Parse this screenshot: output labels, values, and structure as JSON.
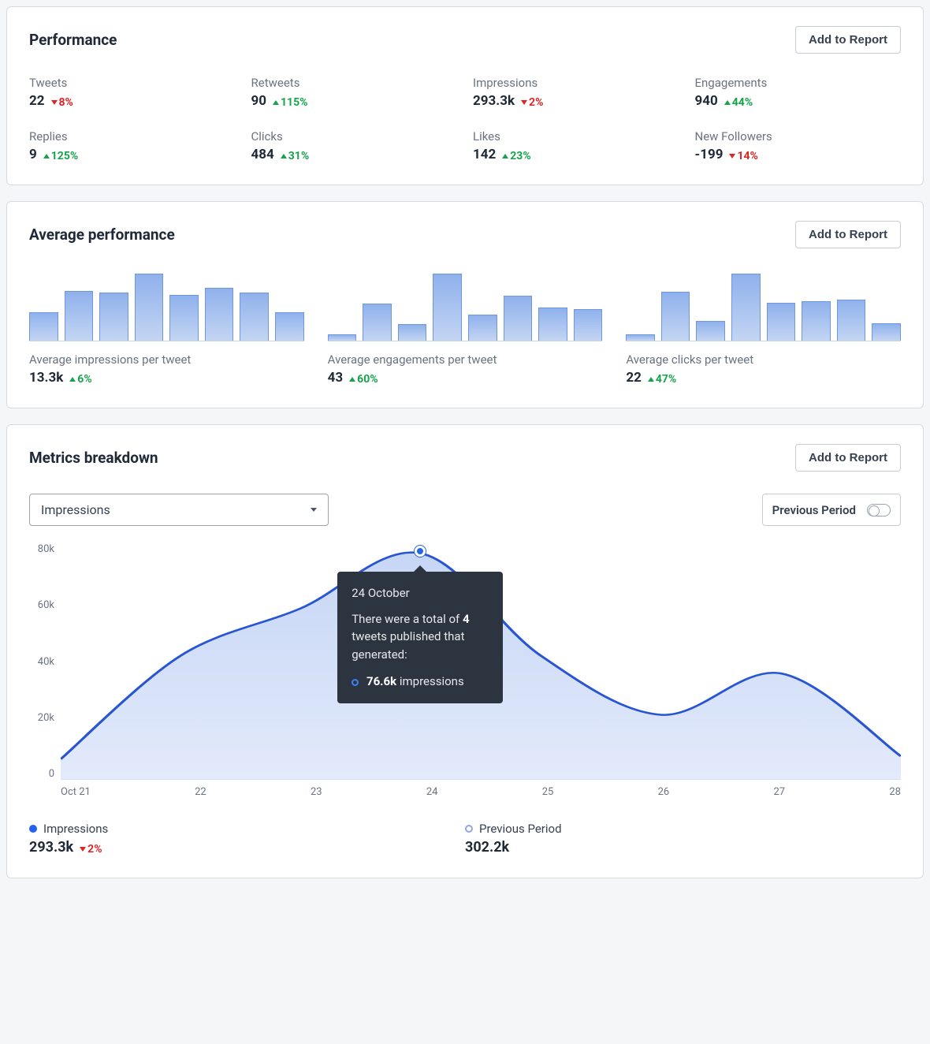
{
  "performance": {
    "title": "Performance",
    "add_btn": "Add to Report",
    "metrics": [
      {
        "label": "Tweets",
        "value": "22",
        "delta": "8%",
        "dir": "down"
      },
      {
        "label": "Retweets",
        "value": "90",
        "delta": "115%",
        "dir": "up"
      },
      {
        "label": "Impressions",
        "value": "293.3k",
        "delta": "2%",
        "dir": "down"
      },
      {
        "label": "Engagements",
        "value": "940",
        "delta": "44%",
        "dir": "up"
      },
      {
        "label": "Replies",
        "value": "9",
        "delta": "125%",
        "dir": "up"
      },
      {
        "label": "Clicks",
        "value": "484",
        "delta": "31%",
        "dir": "up"
      },
      {
        "label": "Likes",
        "value": "142",
        "delta": "23%",
        "dir": "up"
      },
      {
        "label": "New Followers",
        "value": "-199",
        "delta": "14%",
        "dir": "down"
      }
    ]
  },
  "average": {
    "title": "Average performance",
    "add_btn": "Add to Report",
    "items": [
      {
        "label": "Average impressions per tweet",
        "value": "13.3k",
        "delta": "6%",
        "dir": "up"
      },
      {
        "label": "Average engagements per tweet",
        "value": "43",
        "delta": "60%",
        "dir": "up"
      },
      {
        "label": "Average clicks per tweet",
        "value": "22",
        "delta": "47%",
        "dir": "up"
      }
    ]
  },
  "breakdown": {
    "title": "Metrics breakdown",
    "add_btn": "Add to Report",
    "select_value": "Impressions",
    "toggle_label": "Previous Period",
    "tooltip": {
      "date": "24 October",
      "line1": "There were a total of ",
      "tweets": "4",
      "line2": " tweets published that generated:",
      "impressions": "76.6k",
      "impressions_label": " impressions"
    },
    "y_ticks": [
      "80k",
      "60k",
      "40k",
      "20k",
      "0"
    ],
    "x_ticks": [
      "Oct 21",
      "22",
      "23",
      "24",
      "25",
      "26",
      "27",
      "28"
    ],
    "legend": {
      "current_label": "Impressions",
      "current_value": "293.3k",
      "current_delta": "2%",
      "current_dir": "down",
      "prev_label": "Previous Period",
      "prev_value": "302.2k"
    }
  },
  "chart_data": [
    {
      "type": "bar",
      "title": "Average impressions per tweet",
      "values": [
        30,
        52,
        50,
        70,
        48,
        55,
        50,
        30
      ]
    },
    {
      "type": "bar",
      "title": "Average engagements per tweet",
      "values": [
        8,
        50,
        22,
        90,
        35,
        60,
        45,
        42
      ]
    },
    {
      "type": "bar",
      "title": "Average clicks per tweet",
      "values": [
        8,
        62,
        25,
        85,
        48,
        50,
        52,
        22
      ]
    },
    {
      "type": "area",
      "title": "Impressions breakdown",
      "xlabel": "",
      "ylabel": "Impressions",
      "ylim": [
        0,
        80000
      ],
      "categories": [
        "Oct 21",
        "22",
        "23",
        "24",
        "25",
        "26",
        "27",
        "28"
      ],
      "series": [
        {
          "name": "Impressions",
          "values": [
            7000,
            42000,
            58000,
            76600,
            42000,
            22000,
            36000,
            8000
          ]
        }
      ]
    }
  ]
}
